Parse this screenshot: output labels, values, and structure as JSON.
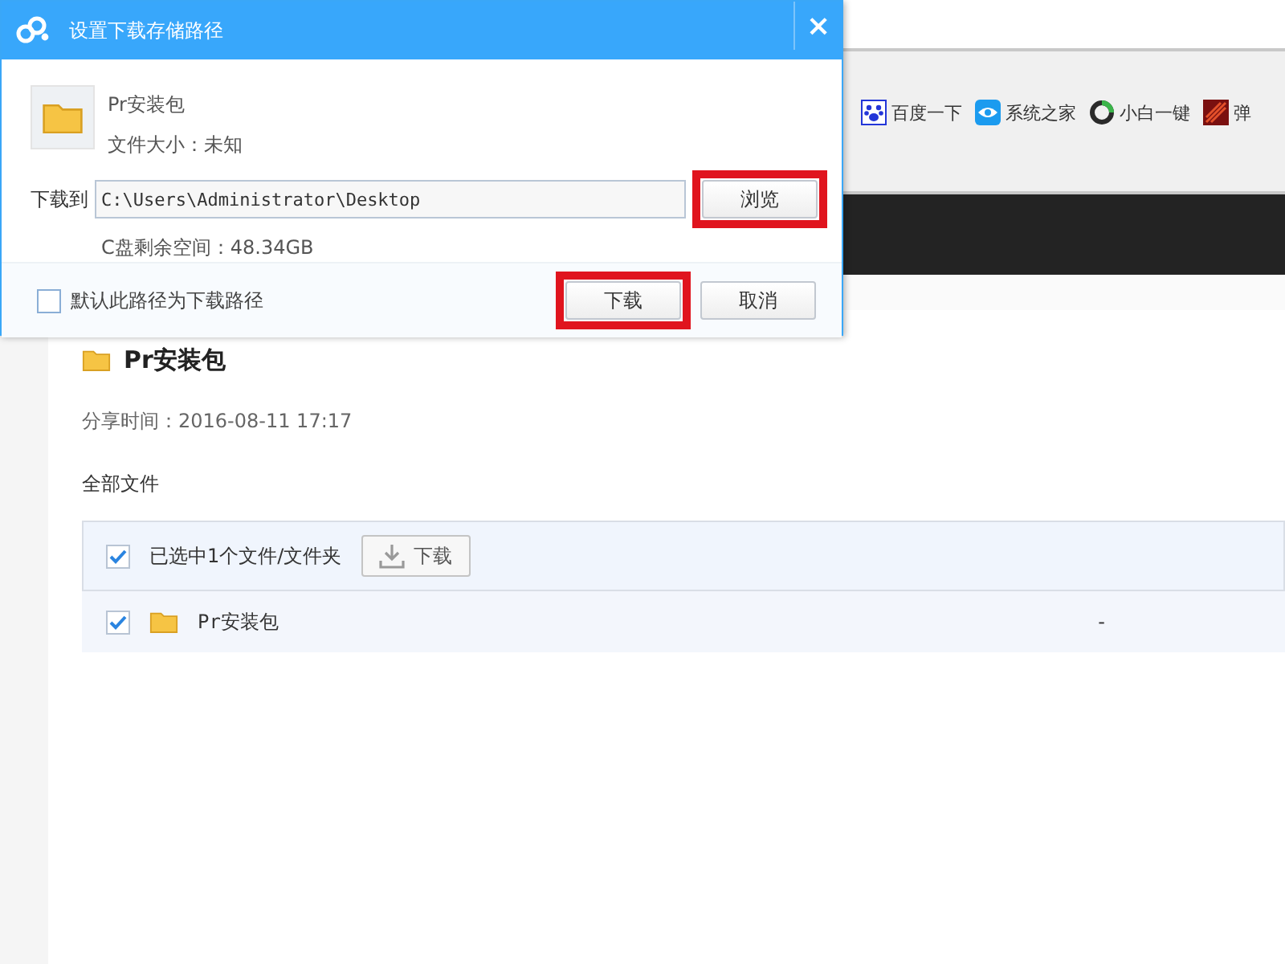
{
  "bookmarks": [
    {
      "label": "百度一下",
      "kind": "paw"
    },
    {
      "label": "系统之家",
      "kind": "eye"
    },
    {
      "label": "小白一键",
      "kind": "cycle"
    },
    {
      "label": "弹",
      "kind": "game"
    }
  ],
  "share": {
    "title": "Pr安装包",
    "share_time": "分享时间：2016-08-11 17:17",
    "section": "全部文件",
    "toolbar": {
      "checked": true,
      "selection_text": "已选中1个文件/文件夹",
      "download_button": "下载"
    },
    "rows": [
      {
        "checked": true,
        "name": "Pr安装包",
        "column_2": "-"
      }
    ]
  },
  "dialog": {
    "title": "设置下载存储路径",
    "close": "×",
    "file": {
      "name": "Pr安装包",
      "size": "文件大小：未知"
    },
    "path_label": "下载到",
    "path_value": "C:\\Users\\Administrator\\Desktop",
    "free_space": "C盘剩余空间：48.34GB",
    "default_path": {
      "label": "默认此路径为下载路径",
      "checked": false
    },
    "browse_button": {
      "label": "浏览",
      "highlighted": true
    },
    "buttons": [
      {
        "label": "下载",
        "highlighted": true
      },
      {
        "label": "取消",
        "highlighted": false
      }
    ]
  }
}
